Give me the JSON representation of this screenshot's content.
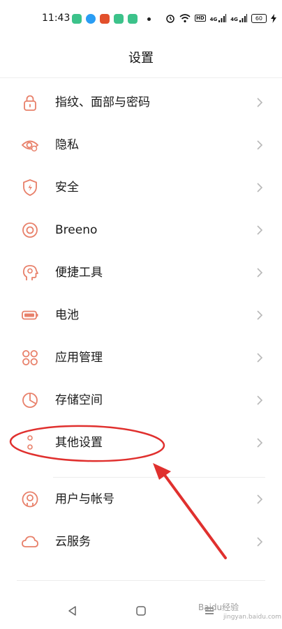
{
  "status": {
    "time": "11:43",
    "battery": "60",
    "signal_label_1": "4G",
    "signal_label_2": "4G",
    "hd_label": "HD",
    "notif_colors": [
      "#3cc28a",
      "#2a9df4",
      "#e2502c",
      "#3cc28a",
      "#3cc28a"
    ]
  },
  "header": {
    "title": "设置"
  },
  "items": [
    {
      "label": "指纹、面部与密码",
      "icon": "lock-icon"
    },
    {
      "label": "隐私",
      "icon": "privacy-eye-icon"
    },
    {
      "label": "安全",
      "icon": "shield-icon"
    },
    {
      "label": "Breeno",
      "icon": "breeno-icon"
    },
    {
      "label": "便捷工具",
      "icon": "tools-head-icon"
    },
    {
      "label": "电池",
      "icon": "battery-icon"
    },
    {
      "label": "应用管理",
      "icon": "apps-grid-icon"
    },
    {
      "label": "存储空间",
      "icon": "storage-pie-icon"
    },
    {
      "label": "其他设置",
      "icon": "dots-icon"
    },
    {
      "label": "用户与帐号",
      "icon": "user-icon"
    },
    {
      "label": "云服务",
      "icon": "cloud-icon"
    }
  ],
  "accent_color": "#e8806a",
  "annotation_color": "#e0302e",
  "watermark": {
    "text": "Baidu经验",
    "sub": "jingyan.baidu.com"
  }
}
